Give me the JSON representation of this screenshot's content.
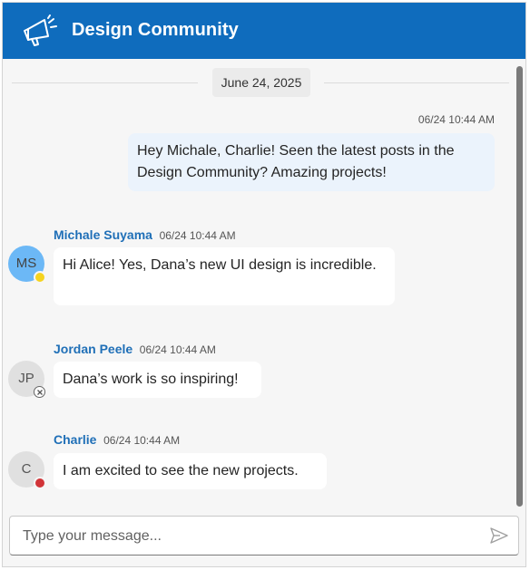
{
  "header": {
    "title": "Design Community",
    "icon": "megaphone-icon",
    "background": "#0f6cbd"
  },
  "chat": {
    "date_separator": "June 24, 2025",
    "messages": [
      {
        "direction": "outgoing",
        "time": "06/24 10:44 AM",
        "text": "Hey Michale, Charlie! Seen the latest posts in the Design Community? Amazing projects!"
      },
      {
        "direction": "incoming",
        "author": "Michale Suyama",
        "initials": "MS",
        "avatar_color": "#6cb8f6",
        "presence": "away",
        "presence_color": "#f5d31f",
        "time": "06/24 10:44 AM",
        "text": "Hi Alice! Yes, Dana’s new UI design is incredible."
      },
      {
        "direction": "incoming",
        "author": "Jordan Peele",
        "initials": "JP",
        "avatar_color": "#e0e0e0",
        "presence": "offline",
        "presence_color": "#8a8a8a",
        "time": "06/24 10:44 AM",
        "text": "Dana’s work is so inspiring!"
      },
      {
        "direction": "incoming",
        "author": "Charlie",
        "initials": "C",
        "avatar_color": "#e0e0e0",
        "presence": "busy",
        "presence_color": "#d13438",
        "time": "06/24 10:44 AM",
        "text": "I am excited to see the new projects."
      }
    ]
  },
  "composer": {
    "placeholder": "Type your message...",
    "value": "",
    "send_icon": "send-icon"
  }
}
